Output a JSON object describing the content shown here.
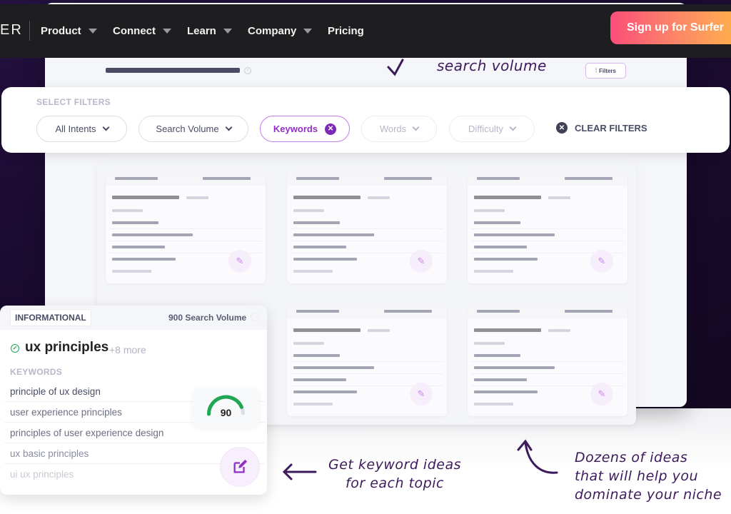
{
  "navbar": {
    "logo_fragment": "ER",
    "items": [
      {
        "label": "Product",
        "has_dropdown": true
      },
      {
        "label": "Connect",
        "has_dropdown": true
      },
      {
        "label": "Learn",
        "has_dropdown": true
      },
      {
        "label": "Company",
        "has_dropdown": true
      },
      {
        "label": "Pricing",
        "has_dropdown": false
      }
    ],
    "cta_label": "Sign up for Surfer",
    "cta_gradient": [
      "#fb4e79",
      "#feb14c"
    ]
  },
  "app_window": {
    "filters_button_label": "Filters",
    "annotation_search_volume": "search volume"
  },
  "filter_panel": {
    "title": "SELECT FILTERS",
    "filters": [
      {
        "label": "All Intents",
        "state": "default"
      },
      {
        "label": "Search Volume",
        "state": "default"
      },
      {
        "label": "Keywords",
        "state": "active"
      },
      {
        "label": "Words",
        "state": "disabled"
      },
      {
        "label": "Difficulty",
        "state": "disabled"
      }
    ],
    "clear_label": "CLEAR FILTERS",
    "accent_color": "#8f2fc3"
  },
  "topic_card": {
    "intent": "INFORMATIONAL",
    "search_volume": "900 Search Volume",
    "title": "ux principles",
    "more": "+8 more",
    "keywords_label": "KEYWORDS",
    "keywords": [
      "principle of ux design",
      "user experience principles",
      "principles of user experience design",
      "ux basic principles",
      "ui ux principles"
    ],
    "score": "90",
    "score_fraction": 0.9,
    "score_color": "#1fa755"
  },
  "annotations": {
    "get_keyword_ideas": [
      "Get keyword ideas",
      "for each topic"
    ],
    "dozens_of_ideas": [
      "Dozens of ideas",
      "that will help you",
      "dominate your niche"
    ]
  }
}
